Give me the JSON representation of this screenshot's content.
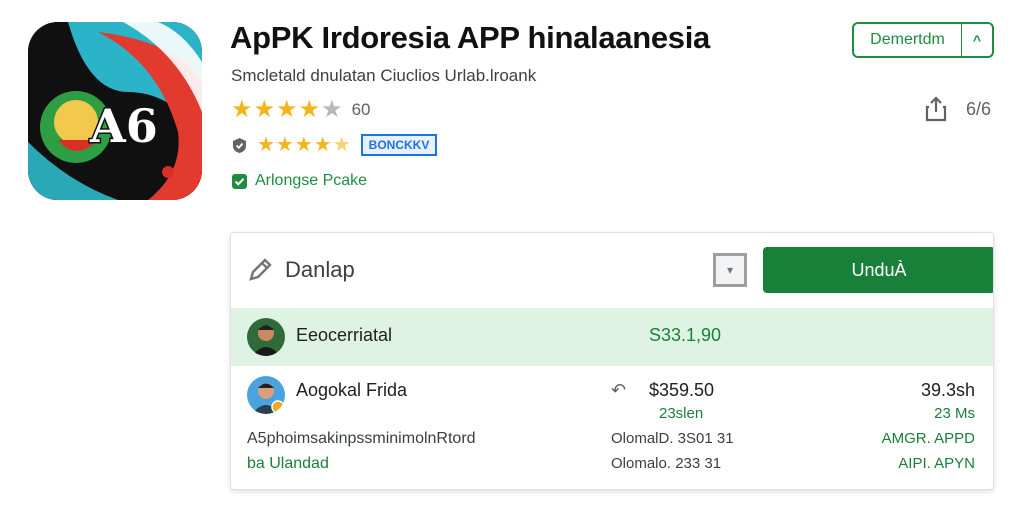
{
  "app": {
    "icon_text": "A6",
    "title": "ApPK Irdoresia APP hinalaanesia",
    "subtitle": "Smcletald dnulatan Ciuclios Urlab.lroank",
    "rating_count": "60",
    "badge": "BONCKKV",
    "verified_label": "Arlongse Pcake",
    "share_count": "6/6"
  },
  "top_button": {
    "label": "Demertdm"
  },
  "card": {
    "title": "Danlap",
    "primary_button": "UnduÀ",
    "highlight_row": {
      "name": "Eeocerriatal",
      "amount": "S33.1,90"
    },
    "row": {
      "name": "Aogokal Frida",
      "amount": "$359.50",
      "amount_sub": "23slen",
      "right_value": "39.3sh",
      "right_sub": "23 Ms"
    },
    "detail_rows": [
      {
        "left": "A5phoimsakinpssminimolnRtord",
        "mid": "OlomalD. 3S01 31",
        "right": "AMGR. APPD"
      },
      {
        "left": "ba Ulandad",
        "mid": "Olomalo. 233 31",
        "right": "AIPI. APYN"
      }
    ]
  },
  "colors": {
    "brand_green": "#188038",
    "star": "#f3b51b",
    "highlight_bg": "#dff3e4",
    "badge_blue": "#1a73e8"
  }
}
